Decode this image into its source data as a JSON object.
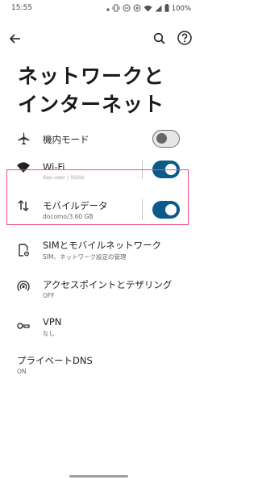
{
  "status_bar": {
    "time": "15:55",
    "battery": "100%",
    "icons": [
      "notification-dot-icon",
      "vibrate-icon",
      "dnd-icon",
      "data-saver-icon",
      "wifi-icon",
      "signal-icon",
      "battery-icon"
    ]
  },
  "topbar": {
    "back_icon": "arrow-back-icon",
    "search_icon": "search-icon",
    "help_icon": "help-icon"
  },
  "page": {
    "title_line1": "ネットワークと",
    "title_line2": "インターネット"
  },
  "settings": {
    "airplane": {
      "title": "機内モード",
      "icon": "airplane-icon",
      "toggle": "off"
    },
    "wifi": {
      "title": "Wi-Fi",
      "subtitle": "4as-user / 5GHz",
      "icon": "wifi-icon",
      "toggle": "on"
    },
    "mobile_data": {
      "title": "モバイルデータ",
      "subtitle": "docomo/3.60 GB",
      "icon": "swap-vertical-icon",
      "toggle": "on"
    },
    "sim": {
      "title": "SIMとモバイルネットワーク",
      "subtitle": "SIM、ネットワーク設定の管理",
      "icon": "sim-settings-icon"
    },
    "hotspot": {
      "title": "アクセスポイントとテザリング",
      "subtitle": "OFF",
      "icon": "hotspot-icon"
    },
    "vpn": {
      "title": "VPN",
      "subtitle": "なし",
      "icon": "vpn-key-icon"
    },
    "private_dns": {
      "title": "プライベートDNS",
      "subtitle": "ON"
    }
  },
  "colors": {
    "toggle_on": "#0b5b8a",
    "highlight": "#ea4a8c"
  }
}
